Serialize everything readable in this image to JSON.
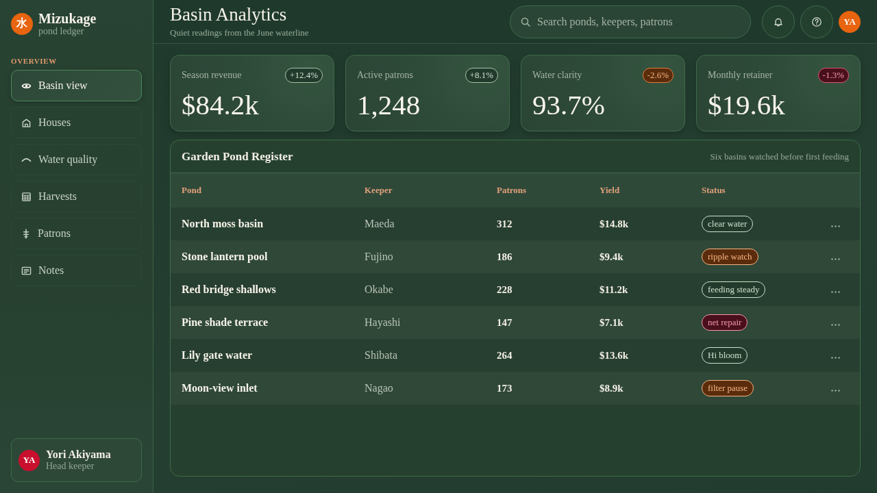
{
  "sidebar": {
    "brand": {
      "logo": "水",
      "name": "Mizukage",
      "tagline": "pond ledger"
    },
    "section": "OVERVIEW",
    "items": [
      {
        "label": "Basin view",
        "selected": true
      },
      {
        "label": "Houses",
        "selected": false
      },
      {
        "label": "Water quality",
        "selected": false
      },
      {
        "label": "Harvests",
        "selected": false
      },
      {
        "label": "Patrons",
        "selected": false
      },
      {
        "label": "Notes",
        "selected": false
      }
    ],
    "user": {
      "initials": "YA",
      "name": "Yori Akiyama",
      "role": "Head keeper"
    }
  },
  "header": {
    "title": "Basin Analytics",
    "subtitle": "Quiet readings from the June waterline",
    "search": {
      "placeholder": "Search ponds, keepers, patrons"
    },
    "avatar": "YA"
  },
  "stats": [
    {
      "label": "Season revenue",
      "delta": "+12.4%",
      "kind": "calm",
      "value": "$84.2k"
    },
    {
      "label": "Active patrons",
      "delta": "+8.1%",
      "kind": "calm",
      "value": "1,248"
    },
    {
      "label": "Water clarity",
      "delta": "-2.6%",
      "kind": "warn",
      "value": "93.7%"
    },
    {
      "label": "Monthly retainer",
      "delta": "-1.3%",
      "kind": "alert",
      "value": "$19.6k"
    }
  ],
  "table": {
    "title": "Garden Pond Register",
    "note": "Six basins watched before first feeding",
    "columns": [
      "Pond",
      "Keeper",
      "Patrons",
      "Yield",
      "Status"
    ],
    "rows": [
      {
        "pond": "North moss basin",
        "keeper": "Maeda",
        "patrons": "312",
        "yield": "$14.8k",
        "status": "clear water",
        "kind": "calm"
      },
      {
        "pond": "Stone lantern pool",
        "keeper": "Fujino",
        "patrons": "186",
        "yield": "$9.4k",
        "status": "ripple watch",
        "kind": "warn"
      },
      {
        "pond": "Red bridge shallows",
        "keeper": "Okabe",
        "patrons": "228",
        "yield": "$11.2k",
        "status": "feeding steady",
        "kind": "calm"
      },
      {
        "pond": "Pine shade terrace",
        "keeper": "Hayashi",
        "patrons": "147",
        "yield": "$7.1k",
        "status": "net repair",
        "kind": "alert"
      },
      {
        "pond": "Lily gate water",
        "keeper": "Shibata",
        "patrons": "264",
        "yield": "$13.6k",
        "status": "Hi bloom",
        "kind": "calm"
      },
      {
        "pond": "Moon-view inlet",
        "keeper": "Nagao",
        "patrons": "173",
        "yield": "$8.9k",
        "status": "filter pause",
        "kind": "warn"
      }
    ]
  }
}
